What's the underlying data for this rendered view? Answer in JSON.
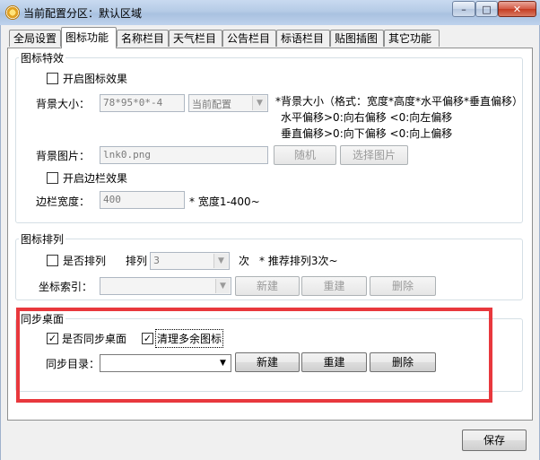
{
  "window": {
    "title": "当前配置分区：默认区域",
    "minimize_glyph": "–",
    "maximize_glyph": "□",
    "close_glyph": "✕"
  },
  "tabs": [
    {
      "label": "全局设置"
    },
    {
      "label": "图标功能",
      "active": true
    },
    {
      "label": "名称栏目"
    },
    {
      "label": "天气栏目"
    },
    {
      "label": "公告栏目"
    },
    {
      "label": "标语栏目"
    },
    {
      "label": "贴图插图"
    },
    {
      "label": "其它功能"
    }
  ],
  "icon_effects": {
    "legend": "图标特效",
    "enable_label": "开启图标效果",
    "enable_checked": false,
    "bg_size_label": "背景大小：",
    "bg_size_value": "78*95*0*-4",
    "preset_value": "当前配置",
    "note_line1": "*背景大小（格式：宽度*高度*水平偏移*垂直偏移）",
    "note_line2": "水平偏移>0:向右偏移  <0:向左偏移",
    "note_line3": "垂直偏移>0:向下偏移  <0:向上偏移",
    "bg_image_label": "背景图片：",
    "bg_image_value": "lnk0.png",
    "random_button": "随机",
    "choose_image_button": "选择图片",
    "border_enable_label": "开启边栏效果",
    "border_enable_checked": false,
    "border_width_label": "边栏宽度：",
    "border_width_value": "400",
    "border_width_note": "* 宽度1-400~"
  },
  "arrange": {
    "legend": "图标排列",
    "arrange_label": "是否排列",
    "arrange_checked": false,
    "row_label": "排列",
    "row_value": "3",
    "times_label": "次",
    "recommend_note": "* 推荐排列3次~",
    "coord_index_label": "坐标索引：",
    "coord_index_value": "",
    "new_button": "新建",
    "rebuild_button": "重建",
    "delete_button": "删除"
  },
  "sync": {
    "legend": "同步桌面",
    "sync_label": "是否同步桌面",
    "sync_checked": true,
    "clean_label": "清理多余图标",
    "clean_checked": true,
    "dir_label": "同步目录：",
    "dir_value": "",
    "new_button": "新建",
    "rebuild_button": "重建",
    "delete_button": "删除"
  },
  "footer": {
    "save_button": "保存"
  },
  "colors": {
    "highlight_border": "#e8383d",
    "panel_bg": "#ffffff",
    "window_bg": "#f0f0f0"
  }
}
